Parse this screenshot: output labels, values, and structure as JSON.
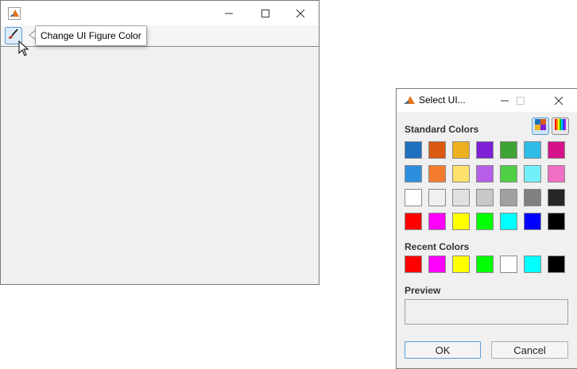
{
  "figure_window": {
    "minimize_glyph": "—",
    "maximize_glyph": "☐",
    "close_glyph": "✕",
    "toolbar": {
      "tool_icon": "paintbrush-icon"
    },
    "tooltip": "Change UI Figure Color"
  },
  "dialog": {
    "title": "Select UI...",
    "minimize_glyph": "—",
    "maximize_glyph": "☐",
    "close_glyph": "✕",
    "standard_label": "Standard Colors",
    "standard_colors": [
      [
        "#1f6fbf",
        "#d95a10",
        "#edb120",
        "#7e1fd6",
        "#3ea335",
        "#2fbde8",
        "#d4138a"
      ],
      [
        "#2e8ede",
        "#f47c2e",
        "#ffe26e",
        "#b55ee8",
        "#4fcf44",
        "#72f0fa",
        "#f06ec4"
      ],
      [
        "#ffffff",
        "#f0f0f0",
        "#e0e0e0",
        "#c8c8c8",
        "#a0a0a0",
        "#808080",
        "#262626"
      ],
      [
        "#ff0000",
        "#ff00ff",
        "#ffff00",
        "#00ff00",
        "#00ffff",
        "#0000ff",
        "#000000"
      ]
    ],
    "recent_label": "Recent Colors",
    "recent_colors": [
      "#ff0000",
      "#ff00ff",
      "#ffff00",
      "#00ff00",
      "#ffffff",
      "#00ffff",
      "#000000"
    ],
    "preview_label": "Preview",
    "ok_label": "OK",
    "cancel_label": "Cancel"
  }
}
